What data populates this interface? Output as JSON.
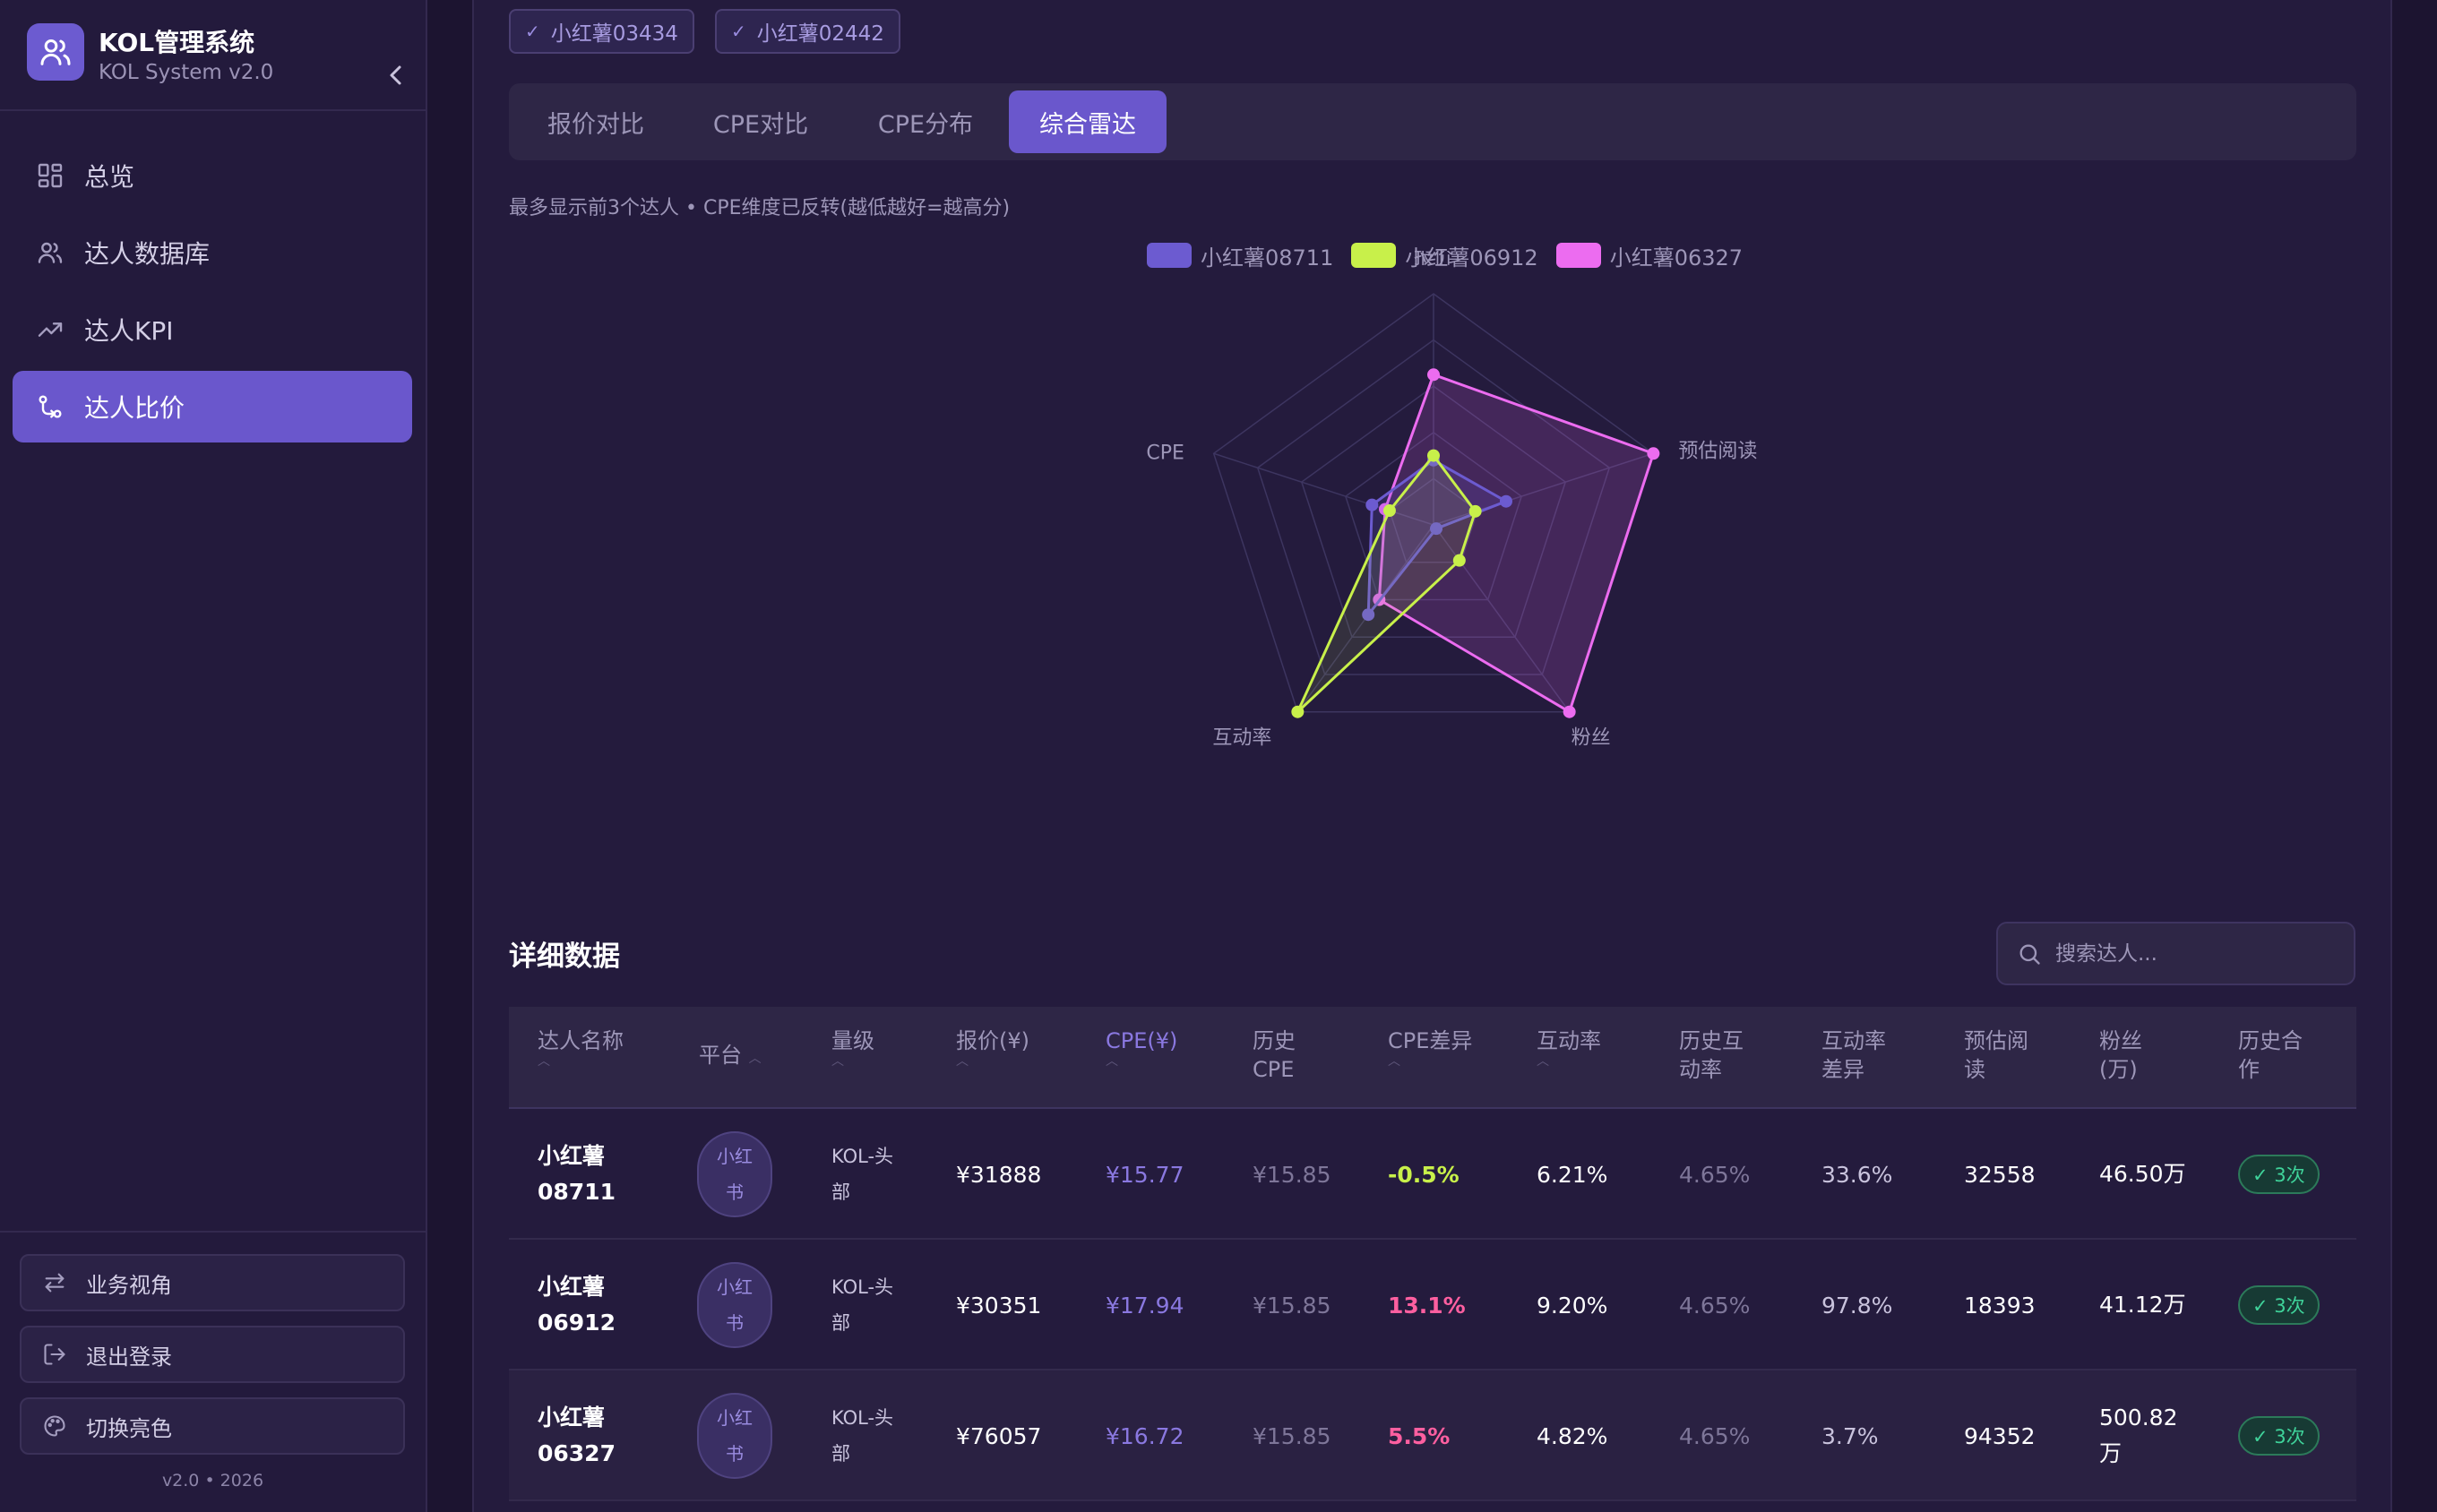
{
  "app": {
    "title": "KOL管理系统",
    "subtitle": "KOL System v2.0",
    "version": "v2.0 • 2026"
  },
  "nav": {
    "items": [
      {
        "label": "总览",
        "icon": "dashboard-icon"
      },
      {
        "label": "达人数据库",
        "icon": "users-icon"
      },
      {
        "label": "达人KPI",
        "icon": "trending-up-icon"
      },
      {
        "label": "达人比价",
        "icon": "compare-icon",
        "active": true
      }
    ]
  },
  "sidebar_footer": {
    "business_view": "业务视角",
    "logout": "退出登录",
    "theme": "切换亮色"
  },
  "selected_chips": [
    "小红薯03434",
    "小红薯02442"
  ],
  "tabs": [
    "报价对比",
    "CPE对比",
    "CPE分布",
    "综合雷达"
  ],
  "active_tab": "综合雷达",
  "chart_note": "最多显示前3个达人 • CPE维度已反转(越低越好=越高分)",
  "chart_data": {
    "type": "radar",
    "axes": [
      "报价",
      "预估阅读",
      "粉丝",
      "互动率",
      "CPE"
    ],
    "range": [
      0,
      1
    ],
    "rings": 5,
    "series": [
      {
        "name": "小红薯08711",
        "color": "#6c5bd0",
        "values": [
          0.28,
          0.33,
          0.02,
          0.48,
          0.28
        ]
      },
      {
        "name": "小红薯06912",
        "color": "#c8f04a",
        "values": [
          0.3,
          0.19,
          0.19,
          1.0,
          0.2
        ]
      },
      {
        "name": "小红薯06327",
        "color": "#ec6cf0",
        "values": [
          0.65,
          1.0,
          1.0,
          0.4,
          0.22
        ]
      }
    ]
  },
  "table": {
    "title": "详细数据",
    "search_placeholder": "搜索达人...",
    "headers": [
      "达人名称",
      "平台",
      "量级",
      "报价(¥)",
      "CPE(¥)",
      "历史CPE",
      "CPE差异",
      "互动率",
      "历史互动率",
      "互动率差异",
      "预估阅读",
      "粉丝(万)",
      "历史合作"
    ],
    "rows": [
      {
        "name": "小红薯08711",
        "platform": "小红书",
        "tier": "KOL-头部",
        "price": "¥31888",
        "cpe": "¥15.77",
        "hist_cpe": "¥15.85",
        "cpe_diff": "-0.5%",
        "cpe_diff_dir": "down",
        "er": "6.21%",
        "hist_er": "4.65%",
        "er_diff": "33.6%",
        "reads": "32558",
        "fans": "46.50万",
        "coop": "✓ 3次"
      },
      {
        "name": "小红薯06912",
        "platform": "小红书",
        "tier": "KOL-头部",
        "price": "¥30351",
        "cpe": "¥17.94",
        "hist_cpe": "¥15.85",
        "cpe_diff": "13.1%",
        "cpe_diff_dir": "up",
        "er": "9.20%",
        "hist_er": "4.65%",
        "er_diff": "97.8%",
        "reads": "18393",
        "fans": "41.12万",
        "coop": "✓ 3次"
      },
      {
        "name": "小红薯06327",
        "platform": "小红书",
        "tier": "KOL-头部",
        "price": "¥76057",
        "cpe": "¥16.72",
        "hist_cpe": "¥15.85",
        "cpe_diff": "5.5%",
        "cpe_diff_dir": "up",
        "er": "4.82%",
        "hist_er": "4.65%",
        "er_diff": "3.7%",
        "reads": "94352",
        "fans": "500.82万",
        "coop": "✓ 3次"
      }
    ]
  }
}
